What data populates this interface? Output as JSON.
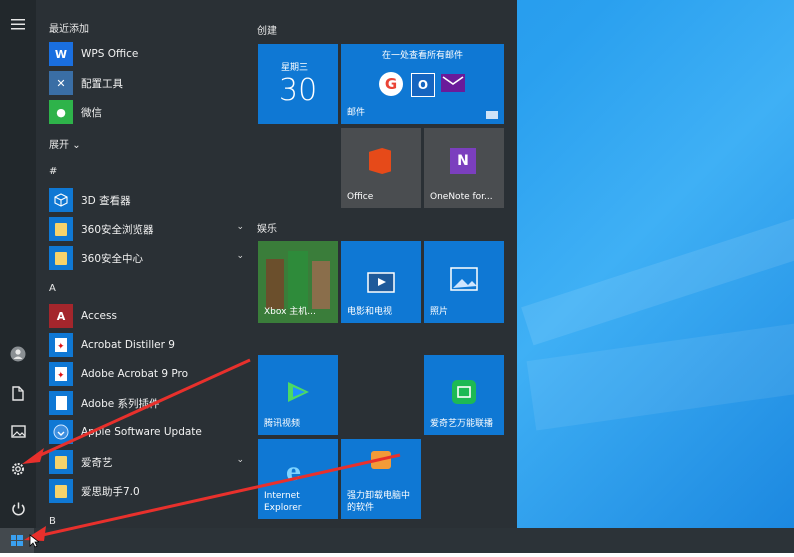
{
  "rail": {
    "icons": [
      "hamburger-icon",
      "user-icon",
      "document-icon",
      "pictures-icon",
      "settings-icon",
      "power-icon"
    ]
  },
  "applist": {
    "recent_header": "最近添加",
    "recent": [
      "WPS Office",
      "配置工具",
      "微信"
    ],
    "expand_label": "展开",
    "hash_header": "#",
    "hash_apps": [
      "3D 查看器",
      "360安全浏览器",
      "360安全中心"
    ],
    "a_header": "A",
    "a_apps": [
      "Access",
      "Acrobat Distiller 9",
      "Adobe Acrobat 9 Pro",
      "Adobe 系列插件",
      "Apple Software Update",
      "爱奇艺",
      "爱思助手7.0"
    ],
    "b_header": "B"
  },
  "tiles": {
    "group1": "创建",
    "calendar": {
      "weekday": "星期三",
      "day": "30"
    },
    "mail": {
      "top": "在一处查看所有邮件",
      "label": "邮件"
    },
    "office": {
      "label": "Office"
    },
    "onenote": {
      "label": "OneNote for..."
    },
    "group2": "娱乐",
    "xbox": {
      "label": "Xbox 主机..."
    },
    "movies": {
      "label": "电影和电视"
    },
    "photos": {
      "label": "照片"
    },
    "tencent": {
      "label": "腾讯视频"
    },
    "iqiyi": {
      "label": "爱奇艺万能联播"
    },
    "ie": {
      "label1": "Internet",
      "label2": "Explorer"
    },
    "uninstall": {
      "label1": "强力卸载电脑中",
      "label2": "的软件"
    }
  },
  "colors": {
    "tile_blue": "#0f78d4",
    "tile_gray": "#4a4d50",
    "menu_bg": "#2a3035",
    "arrow": "#e8302c"
  }
}
